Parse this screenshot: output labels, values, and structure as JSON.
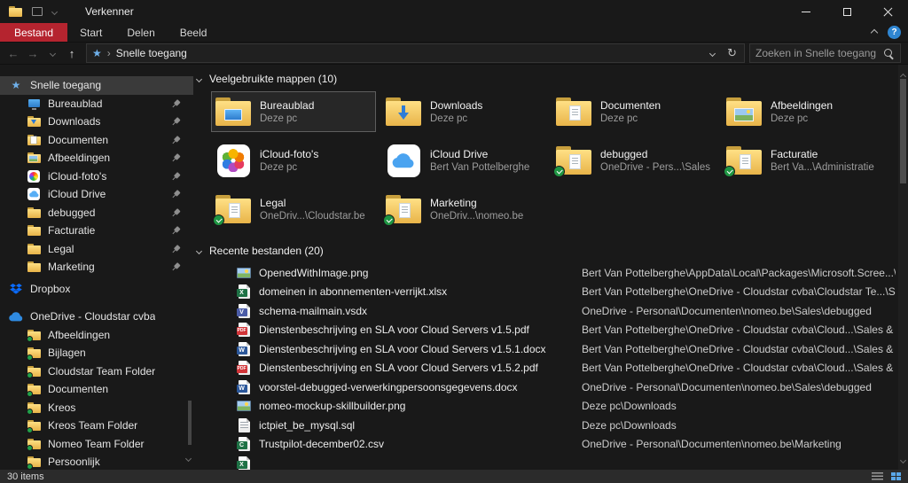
{
  "window": {
    "title": "Verkenner"
  },
  "ribbon": {
    "tabs": [
      "Bestand",
      "Start",
      "Delen",
      "Beeld"
    ]
  },
  "navbar": {
    "location": "Snelle toegang",
    "search_placeholder": "Zoeken in Snelle toegang"
  },
  "icons": {
    "back": "←",
    "forward": "→",
    "up": "↑",
    "refresh": "↻",
    "help": "?",
    "quick_access_star": "★",
    "crumb_sep": "›"
  },
  "colors": {
    "ribbon_file_tab": "#b5242f",
    "folder_yellow": "#e8b449",
    "sync_green": "#1f9643",
    "onedrive_blue": "#2f8ae0",
    "dropbox_blue": "#0a6cff",
    "help_blue": "#2f86d2",
    "selection_gray": "#3a3a3a"
  },
  "sidebar": {
    "items": [
      {
        "label": "Snelle toegang"
      },
      {
        "label": "Bureaublad"
      },
      {
        "label": "Downloads"
      },
      {
        "label": "Documenten"
      },
      {
        "label": "Afbeeldingen"
      },
      {
        "label": "iCloud-foto's"
      },
      {
        "label": "iCloud Drive"
      },
      {
        "label": "debugged"
      },
      {
        "label": "Facturatie"
      },
      {
        "label": "Legal"
      },
      {
        "label": "Marketing"
      },
      {
        "label": "Dropbox"
      },
      {
        "label": "OneDrive - Cloudstar cvba"
      },
      {
        "label": "Afbeeldingen"
      },
      {
        "label": "Bijlagen"
      },
      {
        "label": "Cloudstar Team Folder"
      },
      {
        "label": "Documenten"
      },
      {
        "label": "Kreos"
      },
      {
        "label": "Kreos Team Folder"
      },
      {
        "label": "Nomeo Team Folder"
      },
      {
        "label": "Persoonlijk"
      }
    ]
  },
  "content": {
    "frequent_header": "Veelgebruikte mappen (10)",
    "recent_header": "Recente bestanden (20)",
    "folders": [
      {
        "name": "Bureaublad",
        "sub": "Deze pc"
      },
      {
        "name": "Downloads",
        "sub": "Deze pc"
      },
      {
        "name": "Documenten",
        "sub": "Deze pc"
      },
      {
        "name": "Afbeeldingen",
        "sub": "Deze pc"
      },
      {
        "name": "iCloud-foto's",
        "sub": "Deze pc"
      },
      {
        "name": "iCloud Drive",
        "sub": "Bert Van Pottelberghe"
      },
      {
        "name": "debugged",
        "sub": "OneDrive - Pers...\\Sales"
      },
      {
        "name": "Facturatie",
        "sub": "Bert Va...\\Administratie"
      },
      {
        "name": "Legal",
        "sub": "OneDriv...\\Cloudstar.be"
      },
      {
        "name": "Marketing",
        "sub": "OneDriv...\\nomeo.be"
      }
    ],
    "files": [
      {
        "name": "OpenedWithImage.png",
        "path": "Bert Van Pottelberghe\\AppData\\Local\\Packages\\Microsoft.Scree...\\TempState"
      },
      {
        "name": "domeinen in abonnementen-verrijkt.xlsx",
        "path": "Bert Van Pottelberghe\\OneDrive - Cloudstar cvba\\Cloudstar Te...\\StarringJane"
      },
      {
        "name": "schema-mailmain.vsdx",
        "path": "OneDrive - Personal\\Documenten\\nomeo.be\\Sales\\debugged"
      },
      {
        "name": "Dienstenbeschrijving en SLA voor Cloud Servers v1.5.pdf",
        "path": "Bert Van Pottelberghe\\OneDrive - Cloudstar cvba\\Cloud...\\Sales & Marketing"
      },
      {
        "name": "Dienstenbeschrijving en SLA voor Cloud Servers v1.5.1.docx",
        "path": "Bert Van Pottelberghe\\OneDrive - Cloudstar cvba\\Cloud...\\Sales & Marketing"
      },
      {
        "name": "Dienstenbeschrijving en SLA voor Cloud Servers v1.5.2.pdf",
        "path": "Bert Van Pottelberghe\\OneDrive - Cloudstar cvba\\Cloud...\\Sales & Marketing"
      },
      {
        "name": "voorstel-debugged-verwerkingpersoonsgegevens.docx",
        "path": "OneDrive - Personal\\Documenten\\nomeo.be\\Sales\\debugged"
      },
      {
        "name": "nomeo-mockup-skillbuilder.png",
        "path": "Deze pc\\Downloads"
      },
      {
        "name": "ictpiet_be_mysql.sql",
        "path": "Deze pc\\Downloads"
      },
      {
        "name": "Trustpilot-december02.csv",
        "path": "OneDrive - Personal\\Documenten\\nomeo.be\\Marketing"
      },
      {
        "name": "",
        "path": ""
      }
    ]
  },
  "statusbar": {
    "items_count": "30 items"
  }
}
